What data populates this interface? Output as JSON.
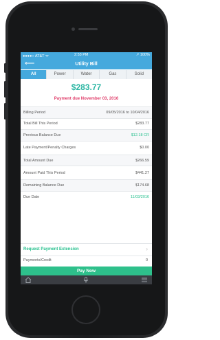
{
  "status_bar": {
    "carrier": "●●●●○ AT&T ᯤ",
    "time": "2:53 PM",
    "battery": "↗ 100%"
  },
  "nav": {
    "back_icon": "back-arrow-icon",
    "title": "Utility Bill"
  },
  "tabs": [
    {
      "label": "All",
      "active": true
    },
    {
      "label": "Power",
      "active": false
    },
    {
      "label": "Water",
      "active": false
    },
    {
      "label": "Gas",
      "active": false
    },
    {
      "label": "Solid",
      "active": false
    }
  ],
  "summary": {
    "amount": "$283.77",
    "due_text": "Payment due November 03, 2016"
  },
  "rows": [
    {
      "label": "Billing Period",
      "value": "09/05/2016 to 10/04/2016"
    },
    {
      "label": "Total Bill This Period",
      "value": "$283.77"
    },
    {
      "label": "Previous Balance Due",
      "value": "$12.18 CR"
    },
    {
      "label": "Late Payment/Penalty Charges",
      "value": "$0.00"
    },
    {
      "label": "Total Amount Due",
      "value": "$266.59"
    },
    {
      "label": "Amount Paid This Period",
      "value": "$441.27"
    },
    {
      "label": "Remaining Balance Due",
      "value": "$174.68"
    },
    {
      "label": "Due Date",
      "value": "11/03/2016"
    }
  ],
  "actions": {
    "extension_label": "Request Payment Extension",
    "payments_label": "Payments/Credit",
    "payments_value": "0",
    "pay_now_label": "Pay Now"
  },
  "tab_bar": {
    "icons": [
      "home-icon",
      "microphone-icon",
      "menu-icon"
    ]
  },
  "colors": {
    "header": "#45a9dd",
    "accent_green": "#27c08e",
    "due_pink": "#e0406c",
    "amount": "#2bb6a3"
  }
}
